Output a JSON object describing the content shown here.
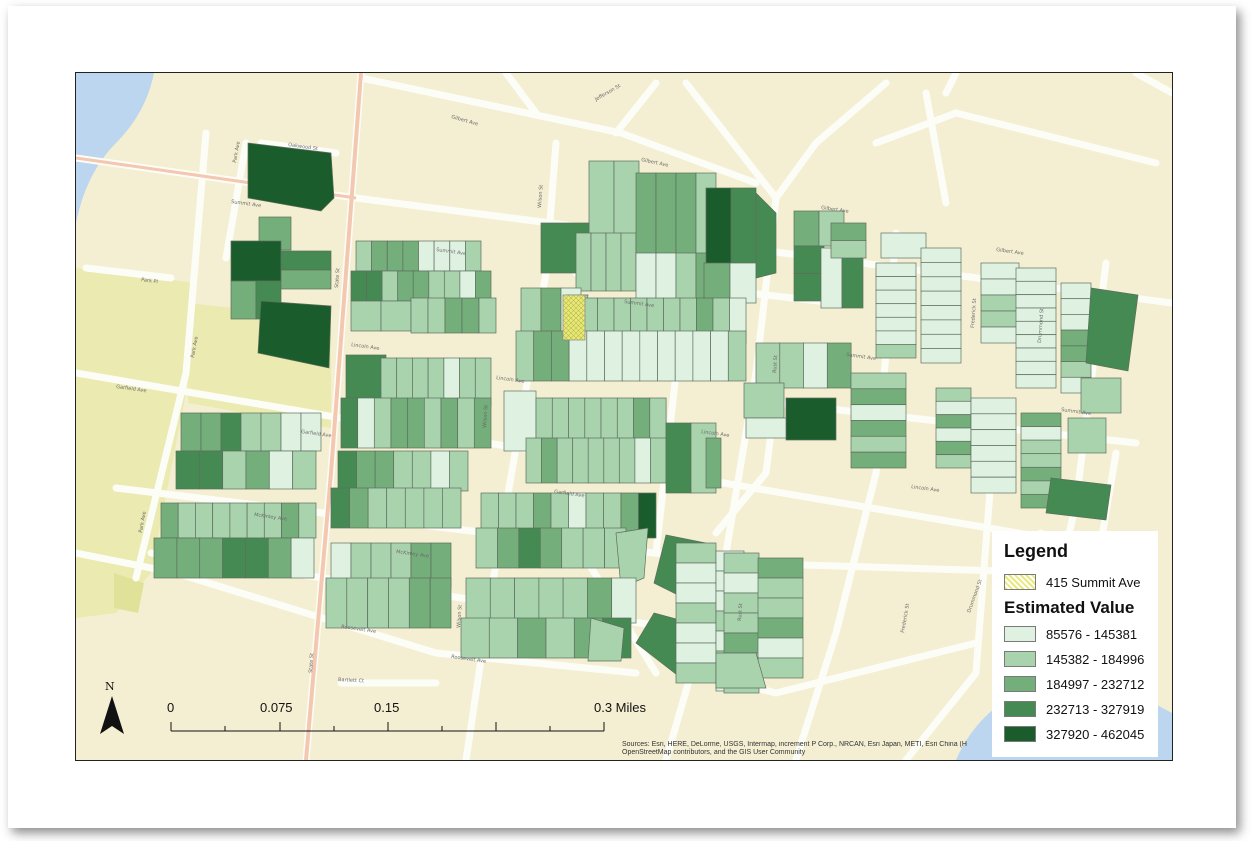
{
  "legend": {
    "title": "Legend",
    "subject_label": "415 Summit Ave",
    "subject_color": "#e9e97a",
    "value_title": "Estimated Value",
    "classes": [
      {
        "label": "85576 - 145381",
        "color": "#dff2e2"
      },
      {
        "label": "145382 - 184996",
        "color": "#a9d3ad"
      },
      {
        "label": "184997 - 232712",
        "color": "#73ae7b"
      },
      {
        "label": "232713 - 327919",
        "color": "#448a52"
      },
      {
        "label": "327920 - 462045",
        "color": "#1a5c2c"
      }
    ]
  },
  "north_arrow": {
    "label": "N",
    "icon": "north-arrow-icon"
  },
  "scalebar": {
    "labels": [
      "0",
      "0.075",
      "0.15",
      "0.3 Miles"
    ]
  },
  "attribution": {
    "line1": "Sources: Esri, HERE, DeLorme, USGS, Intermap, increment P Corp., NRCAN, Esri Japan, METI, Esri China (H",
    "line2": "OpenStreetMap contributors, and the GIS User Community"
  },
  "map": {
    "water_color": "#bdd6ef",
    "land_color": "#f4efd2",
    "road_labels": [
      "Summit Ave",
      "Gilbert Ave",
      "Lincoln Ave",
      "Garfield Ave",
      "McKinley Ave",
      "Roosevelt Ave",
      "Park Ave",
      "Park Pl",
      "Oakwood St",
      "State St",
      "Wilson St",
      "Rust St",
      "Frederick St",
      "Drummond St",
      "Bartlett Ct",
      "Jefferson St"
    ]
  }
}
